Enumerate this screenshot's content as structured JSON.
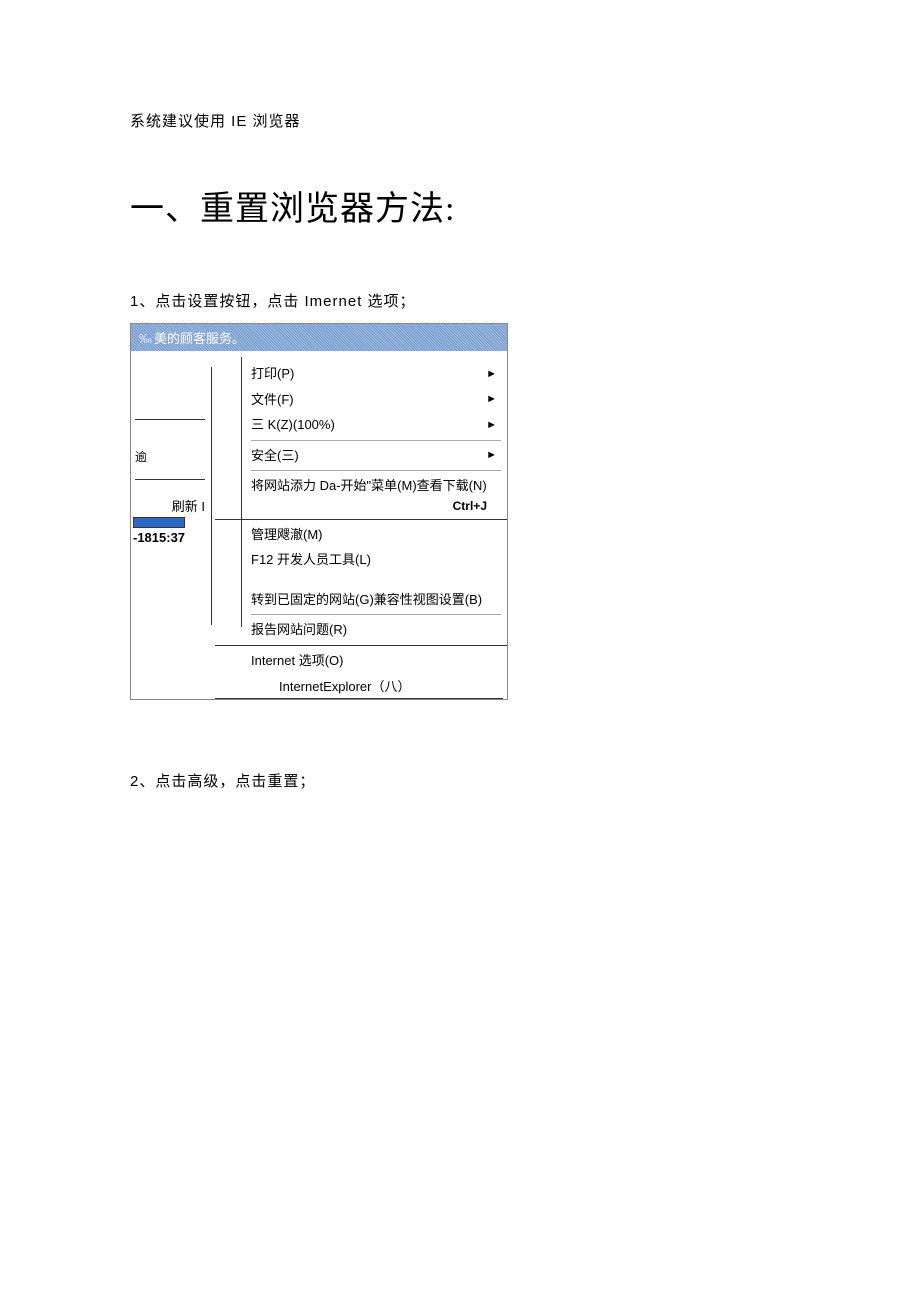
{
  "intro": "系统建议使用 IE 浏览器",
  "heading": "一、重置浏览器方法:",
  "step1": "1、点击设置按钮，点击 Imernet 选项；",
  "menu": {
    "title_prefix": "‰",
    "title": "美的顾客服务。",
    "left": {
      "yu": "逾",
      "refresh": "刷新 I",
      "time": "-1815:37"
    },
    "items": {
      "print": "打印(P)",
      "file": "文件(F)",
      "zoom": "三 K(Z)(100%)",
      "safety": "安全(三)",
      "addsite": "将网站添力 Da-开始\"菜单(M)查看下载(N)",
      "shortcut": "Ctrl+J",
      "manage": "管理飕澈(M)",
      "f12": "F12 开发人员工具(L)",
      "pinned": "转到已固定的网站(G)兼容性视图设置(B)",
      "report": "报告网站问题(R)",
      "internetopt": "Internet 选项(O)",
      "about": "InternetExplorer（八）"
    },
    "arrow": "►"
  },
  "step2": "2、点击高级，点击重置；"
}
